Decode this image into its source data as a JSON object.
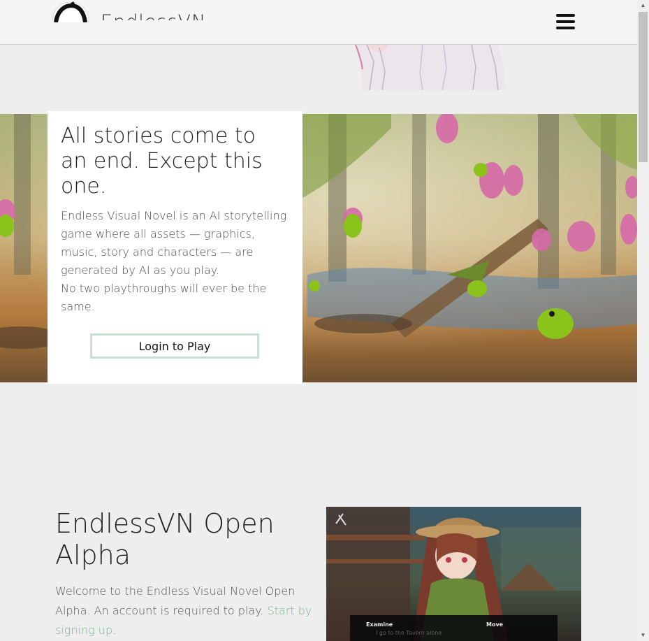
{
  "header": {
    "brand": "EndlessVN",
    "menu_label": "menu"
  },
  "hero": {
    "title": "All stories come to an end. Except this one.",
    "description": "Endless Visual Novel is an AI storytelling game where all assets — graphics, music, story and characters — are generated by AI as you play.",
    "tagline": "No two playthroughs will ever be the same.",
    "cta_label": "Login to Play"
  },
  "alpha": {
    "title": "EndlessVN Open Alpha",
    "text": "Welcome to the Endless Visual Novel Open Alpha. An account is required to play.",
    "link_text": "Start by signing up",
    "trailing": "."
  },
  "game_screenshot": {
    "option_1": "Examine",
    "option_2": "Move",
    "dialogue": "I go to the Tavern alone."
  },
  "colors": {
    "accent_green": "#79b58c",
    "button_border": "#c8dfd1",
    "background": "#eeeeee"
  }
}
